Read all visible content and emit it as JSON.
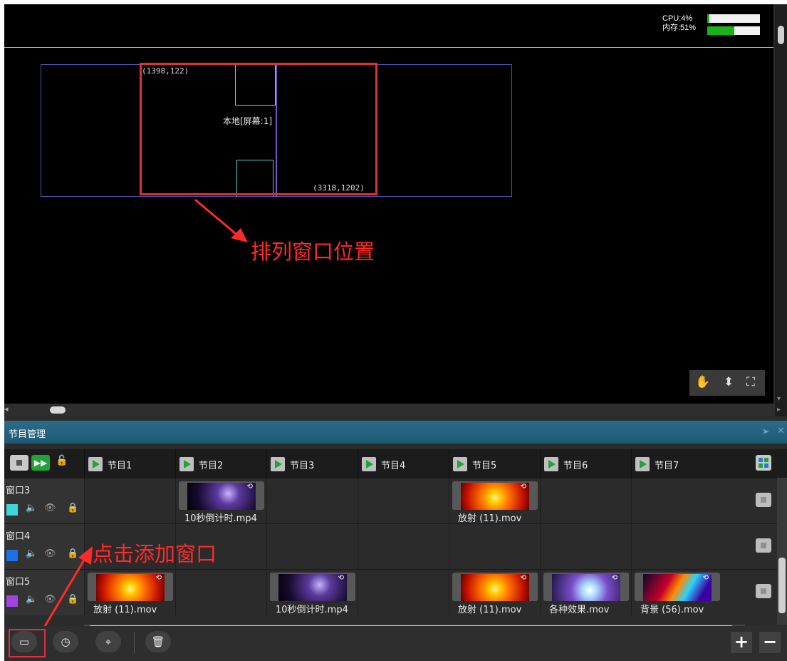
{
  "stats": {
    "cpu_label": "CPU:4%",
    "cpu_value": 0.04,
    "mem_label": "内存:51%",
    "mem_value": 0.51
  },
  "layout_view": {
    "coord_topleft": "(1398,122)",
    "coord_bottomright": "(3318,1202)",
    "screen_label": "本地[屏幕:1]",
    "annotation_arrange": "排列窗口位置"
  },
  "view_tools": {
    "hand_icon": "hand-icon",
    "arrow_icon": "up-down-arrow-icon",
    "fit_icon": "fit-screen-icon"
  },
  "panel": {
    "title": "节目管理"
  },
  "programs": [
    "节目1",
    "节目2",
    "节目3",
    "节目4",
    "节目5",
    "节目6",
    "节目7"
  ],
  "windows": [
    {
      "name": "窗口3",
      "color": "#3ed6d6",
      "clips": [
        null,
        "10秒倒计时.mp4",
        null,
        null,
        "放射 (11).mov",
        null,
        null
      ]
    },
    {
      "name": "窗口4",
      "color": "#1e6fe0",
      "clips": [
        null,
        null,
        null,
        null,
        null,
        null,
        null
      ]
    },
    {
      "name": "窗口5",
      "color": "#a245e0",
      "clips": [
        "放射 (11).mov",
        null,
        "10秒倒计时.mp4",
        null,
        "放射 (11).mov",
        "各种效果.mov",
        "背景 (56).mov"
      ]
    }
  ],
  "annotation_add": "点击添加窗口",
  "bottom_toolbar": {
    "icons": [
      "window-icon",
      "clock-icon",
      "locate-icon",
      "trash-icon"
    ],
    "plus": "+",
    "minus": "−"
  },
  "colors": {
    "highlight": "#e0303c",
    "annotation": "#ff2a2a",
    "play": "#22a33a"
  }
}
